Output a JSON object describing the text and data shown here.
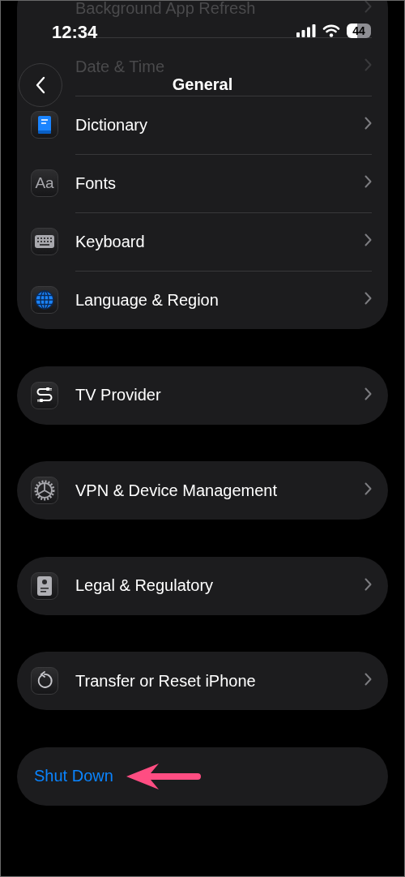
{
  "status_bar": {
    "time": "12:34",
    "battery": "44"
  },
  "nav": {
    "title": "General"
  },
  "groups": [
    {
      "items": [
        {
          "label": "Background App Refresh",
          "kind": "plain",
          "faded": true
        },
        {
          "label": "Date & Time",
          "kind": "plain",
          "faded": true
        },
        {
          "label": "Dictionary",
          "kind": "book",
          "faded": false
        },
        {
          "label": "Fonts",
          "kind": "letters",
          "icon_text": "Aa",
          "faded": false
        },
        {
          "label": "Keyboard",
          "kind": "keyboard",
          "faded": false
        },
        {
          "label": "Language & Region",
          "kind": "globe",
          "faded": false
        }
      ]
    },
    {
      "items": [
        {
          "label": "TV Provider",
          "kind": "cable",
          "faded": false
        }
      ]
    },
    {
      "items": [
        {
          "label": "VPN & Device Management",
          "kind": "gear",
          "faded": false
        }
      ]
    },
    {
      "items": [
        {
          "label": "Legal & Regulatory",
          "kind": "document",
          "faded": false
        }
      ]
    },
    {
      "items": [
        {
          "label": "Transfer or Reset iPhone",
          "kind": "reset",
          "faded": false
        }
      ]
    }
  ],
  "shut_down": {
    "label": "Shut Down"
  },
  "annotation": {
    "kind": "arrow"
  }
}
